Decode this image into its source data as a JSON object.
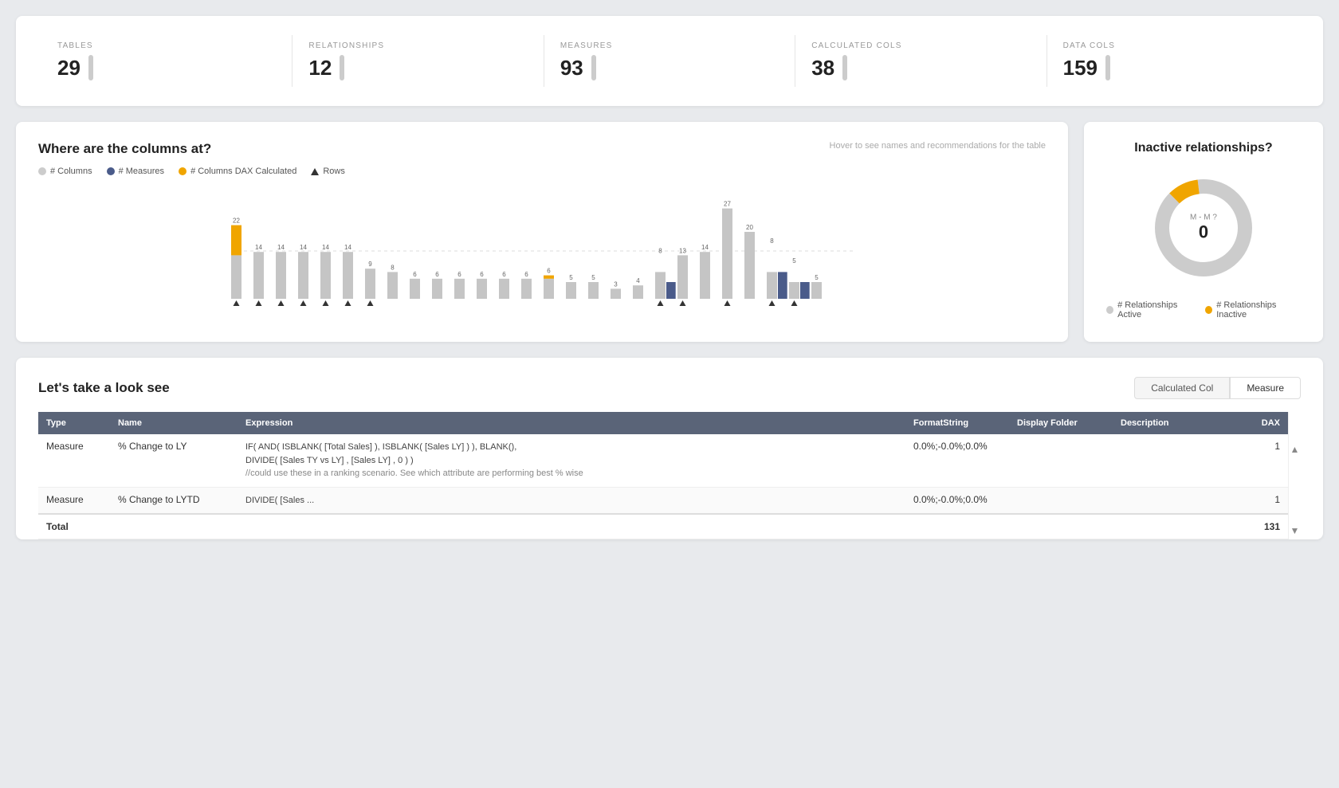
{
  "stats": {
    "items": [
      {
        "label": "TABLES",
        "value": "29"
      },
      {
        "label": "RELATIONSHIPS",
        "value": "12"
      },
      {
        "label": "MEASURES",
        "value": "93"
      },
      {
        "label": "CALCULATED COLS",
        "value": "38"
      },
      {
        "label": "DATA COLS",
        "value": "159"
      }
    ]
  },
  "columnsChart": {
    "title": "Where are the columns at?",
    "subtitle": "Hover to see names and recommendations for the table",
    "legend": [
      {
        "label": "# Columns",
        "type": "dot",
        "color": "#ccc"
      },
      {
        "label": "# Measures",
        "type": "dot",
        "color": "#4a5b8a"
      },
      {
        "label": "# Columns DAX Calculated",
        "type": "dot",
        "color": "#f0a500"
      },
      {
        "label": "Rows",
        "type": "triangle",
        "color": "#333"
      }
    ],
    "bars": [
      {
        "columns": 13,
        "measures": 0,
        "dax": 9,
        "label": "22",
        "showTriangle": true
      },
      {
        "columns": 14,
        "measures": 0,
        "dax": 0,
        "label": "14",
        "showTriangle": true
      },
      {
        "columns": 14,
        "measures": 0,
        "dax": 0,
        "label": "14",
        "showTriangle": true
      },
      {
        "columns": 14,
        "measures": 0,
        "dax": 0,
        "label": "14",
        "showTriangle": true
      },
      {
        "columns": 14,
        "measures": 0,
        "dax": 0,
        "label": "14",
        "showTriangle": true
      },
      {
        "columns": 14,
        "measures": 0,
        "dax": 0,
        "label": "14",
        "showTriangle": true
      },
      {
        "columns": 9,
        "measures": 0,
        "dax": 0,
        "label": "9",
        "showTriangle": true
      },
      {
        "columns": 8,
        "measures": 0,
        "dax": 0,
        "label": "8",
        "showTriangle": false
      },
      {
        "columns": 6,
        "measures": 0,
        "dax": 0,
        "label": "6",
        "showTriangle": false
      },
      {
        "columns": 6,
        "measures": 0,
        "dax": 0,
        "label": "6",
        "showTriangle": false
      },
      {
        "columns": 6,
        "measures": 0,
        "dax": 0,
        "label": "6",
        "showTriangle": false
      },
      {
        "columns": 6,
        "measures": 0,
        "dax": 0,
        "label": "6",
        "showTriangle": false
      },
      {
        "columns": 6,
        "measures": 0,
        "dax": 0,
        "label": "6",
        "showTriangle": false
      },
      {
        "columns": 6,
        "measures": 0,
        "dax": 0,
        "label": "6",
        "showTriangle": false
      },
      {
        "columns": 6,
        "measures": 0,
        "dax": 1,
        "label": "6",
        "showTriangle": false
      },
      {
        "columns": 5,
        "measures": 0,
        "dax": 0,
        "label": "5",
        "showTriangle": false
      },
      {
        "columns": 5,
        "measures": 0,
        "dax": 0,
        "label": "5",
        "showTriangle": false
      },
      {
        "columns": 3,
        "measures": 0,
        "dax": 0,
        "label": "3",
        "showTriangle": false
      },
      {
        "columns": 4,
        "measures": 0,
        "dax": 0,
        "label": "4",
        "showTriangle": false
      },
      {
        "columns": 8,
        "measures": 5,
        "dax": 0,
        "label": "8",
        "showTriangle": true
      },
      {
        "columns": 13,
        "measures": 0,
        "dax": 0,
        "label": "13",
        "showTriangle": true
      },
      {
        "columns": 14,
        "measures": 0,
        "dax": 0,
        "label": "14",
        "showTriangle": false
      },
      {
        "columns": 27,
        "measures": 0,
        "dax": 0,
        "label": "27",
        "showTriangle": true
      },
      {
        "columns": 20,
        "measures": 0,
        "dax": 0,
        "label": "20",
        "showTriangle": false
      },
      {
        "columns": 8,
        "measures": 8,
        "dax": 0,
        "label": "8",
        "showTriangle": true
      },
      {
        "columns": 5,
        "measures": 5,
        "dax": 0,
        "label": "5",
        "showTriangle": true
      },
      {
        "columns": 5,
        "measures": 0,
        "dax": 0,
        "label": "5",
        "showTriangle": false
      }
    ]
  },
  "donutChart": {
    "title": "Inactive relationships?",
    "centerLabel": "M - M ?",
    "centerValue": "0",
    "activeAngle": 320,
    "inactiveAngle": 40,
    "colors": {
      "active": "#ccc",
      "inactive": "#f0a500"
    },
    "legend": [
      {
        "label": "# Relationships Active",
        "color": "#ccc"
      },
      {
        "label": "# Relationships Inactive",
        "color": "#f0a500"
      }
    ]
  },
  "bottomSection": {
    "title": "Let's take a look see",
    "tabs": [
      {
        "label": "Calculated Col",
        "active": false
      },
      {
        "label": "Measure",
        "active": true
      }
    ],
    "table": {
      "headers": [
        "Type",
        "Name",
        "Expression",
        "FormatString",
        "Display Folder",
        "Description",
        "DAX"
      ],
      "rows": [
        {
          "type": "Measure",
          "name": "% Change to LY",
          "expression": "IF( AND( ISBLANK( [Total Sales] ), ISBLANK( [Sales LY] ) ), BLANK(),\nDIVIDE( [Sales TY vs LY] , [Sales LY] , 0 ) )\n//could use these in a ranking scenario. See which attribute are performing best % wise",
          "formatString": "0.0%;-0.0%;0.0%",
          "displayFolder": "",
          "description": "",
          "dax": "1"
        },
        {
          "type": "Measure",
          "name": "% Change to LYTD",
          "expression": "DIVIDE( [Sales ...",
          "formatString": "0.0%;-0.0%;0.0%",
          "displayFolder": "",
          "description": "",
          "dax": "1"
        }
      ],
      "totalRow": {
        "label": "Total",
        "dax": "131"
      }
    }
  }
}
